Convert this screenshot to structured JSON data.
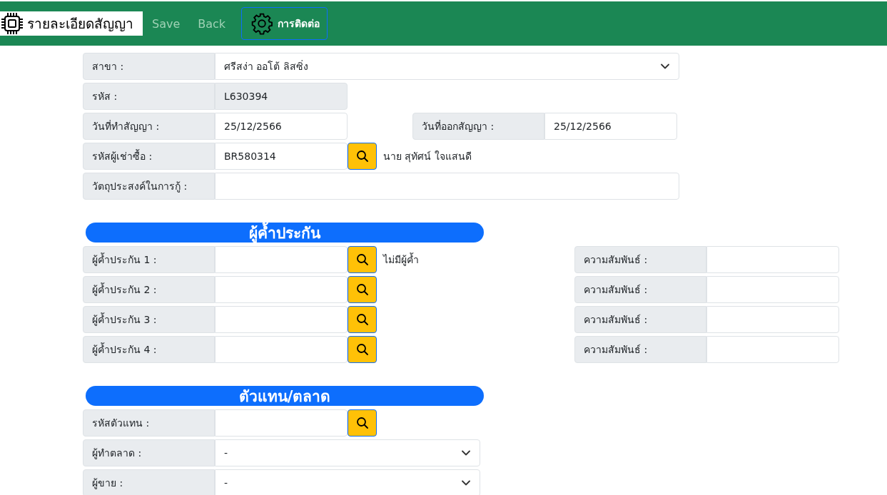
{
  "toolbar": {
    "title": "รายละเอียดสัญญา",
    "actions": [
      {
        "label": "Save",
        "kind": "link"
      },
      {
        "label": "Back",
        "kind": "link"
      },
      {
        "label": "การติดต่อ",
        "kind": "button"
      }
    ]
  },
  "sections": [
    {
      "kind": "details",
      "rows": [
        {
          "kind": "select",
          "label": "สาขา :",
          "value": "ศรีสง่า ออโต้ ลิสซิ่ง"
        },
        {
          "kind": "readonly",
          "label": "รหัส :",
          "value": "L630394"
        },
        {
          "kind": "pair",
          "label": "วันที่ทำสัญญา :",
          "value": "25/12/2566",
          "label_2": "วันที่ออกสัญญา :",
          "value_2": "25/12/2566"
        },
        {
          "kind": "lookup",
          "label": "รหัสผู้เช่าซื้อ :",
          "value": "BR580314",
          "note": "นาย สุทัศน์ ใจแสนดี"
        },
        {
          "kind": "text",
          "label": "วัตถุประสงค์ในการกู้ :"
        }
      ]
    },
    {
      "kind": "guarantors",
      "heading": "ผู้ค้ำประกัน",
      "rows": [
        {
          "kind": "lookup",
          "label": "ผู้ค้ำประกัน 1 :",
          "note": "ไม่มีผู้ค้ำ",
          "label_2": "ความสัมพันธ์ :"
        },
        {
          "kind": "lookup",
          "label": "ผู้ค้ำประกัน 2 :",
          "label_2": "ความสัมพันธ์ :"
        },
        {
          "kind": "lookup",
          "label": "ผู้ค้ำประกัน 3 :",
          "label_2": "ความสัมพันธ์ :"
        },
        {
          "kind": "lookup",
          "label": "ผู้ค้ำประกัน 4 :",
          "label_2": "ความสัมพันธ์ :"
        }
      ]
    },
    {
      "kind": "agent",
      "heading": "ตัวแทน/ตลาด",
      "rows": [
        {
          "kind": "lookup",
          "label": "รหัสตัวแทน :"
        },
        {
          "kind": "select",
          "label": "ผู้ทำตลาด :",
          "value": "-"
        },
        {
          "kind": "select",
          "label": "ผู้ขาย :",
          "value": "-"
        }
      ]
    }
  ]
}
